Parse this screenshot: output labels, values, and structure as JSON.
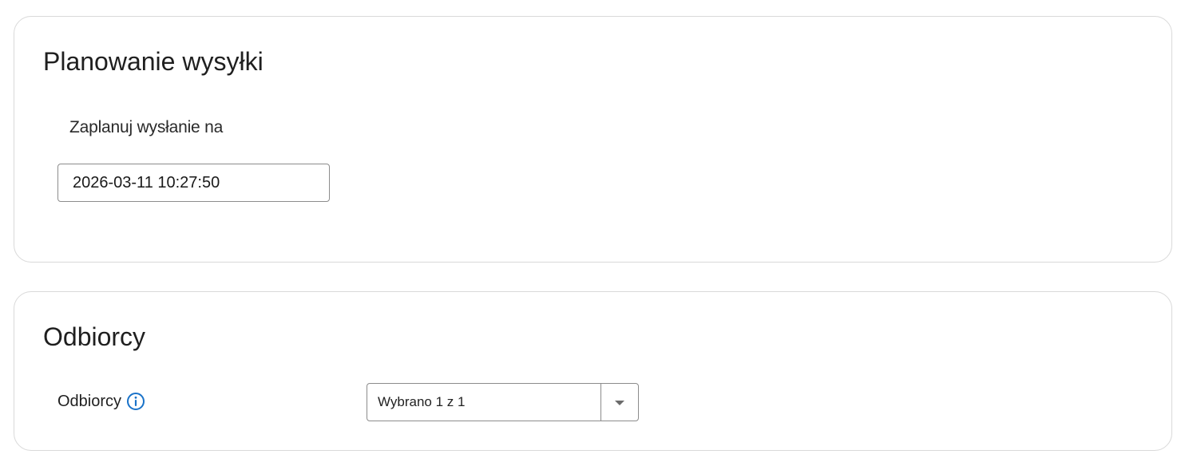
{
  "schedule": {
    "title": "Planowanie wysyłki",
    "label": "Zaplanuj wysłanie na",
    "datetime_value": "2026-03-11 10:27:50"
  },
  "recipients": {
    "title": "Odbiorcy",
    "label": "Odbiorcy",
    "info_icon": "info-circle-icon",
    "select_value": "Wybrano 1 z 1",
    "toggle_icon": "caret-down-icon"
  },
  "colors": {
    "info_icon": "#1a73c9",
    "card_border": "#d9d9d9",
    "input_border": "#8c8c8c"
  }
}
